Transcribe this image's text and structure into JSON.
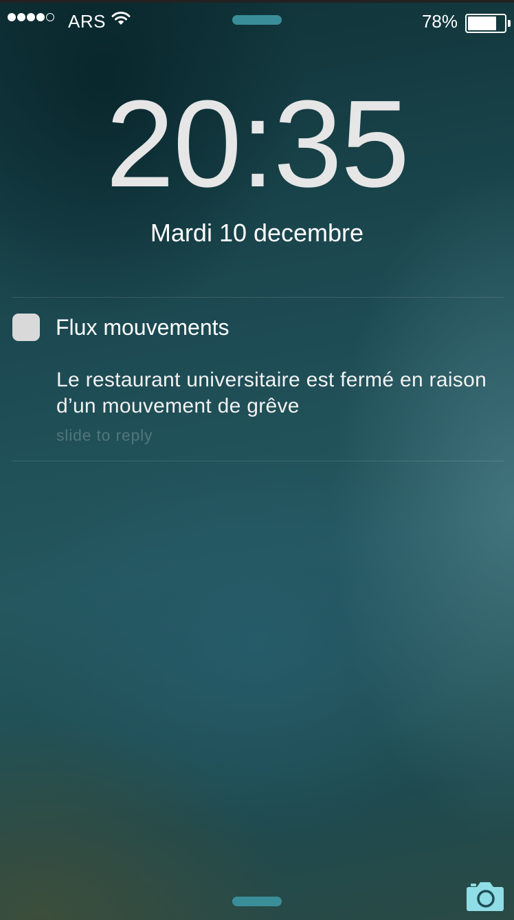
{
  "status_bar": {
    "signal_bars": 5,
    "signal_filled": 4,
    "carrier": "ARS",
    "wifi_icon": "wifi-icon",
    "battery_percent": "78%",
    "battery_level": 0.78
  },
  "lock_screen": {
    "time": "20:35",
    "date": "Mardi 10 decembre"
  },
  "notification": {
    "app_icon": "app-icon",
    "app_name": "Flux mouvements",
    "body": "Le restaurant universitaire est fermé en raison d’un mouvement de grêve",
    "hint": "slide to reply"
  },
  "camera_icon": "camera-icon",
  "colors": {
    "accent": "#3a8e9a",
    "camera": "#8fdde6",
    "app_icon": "#d9d9d9"
  }
}
